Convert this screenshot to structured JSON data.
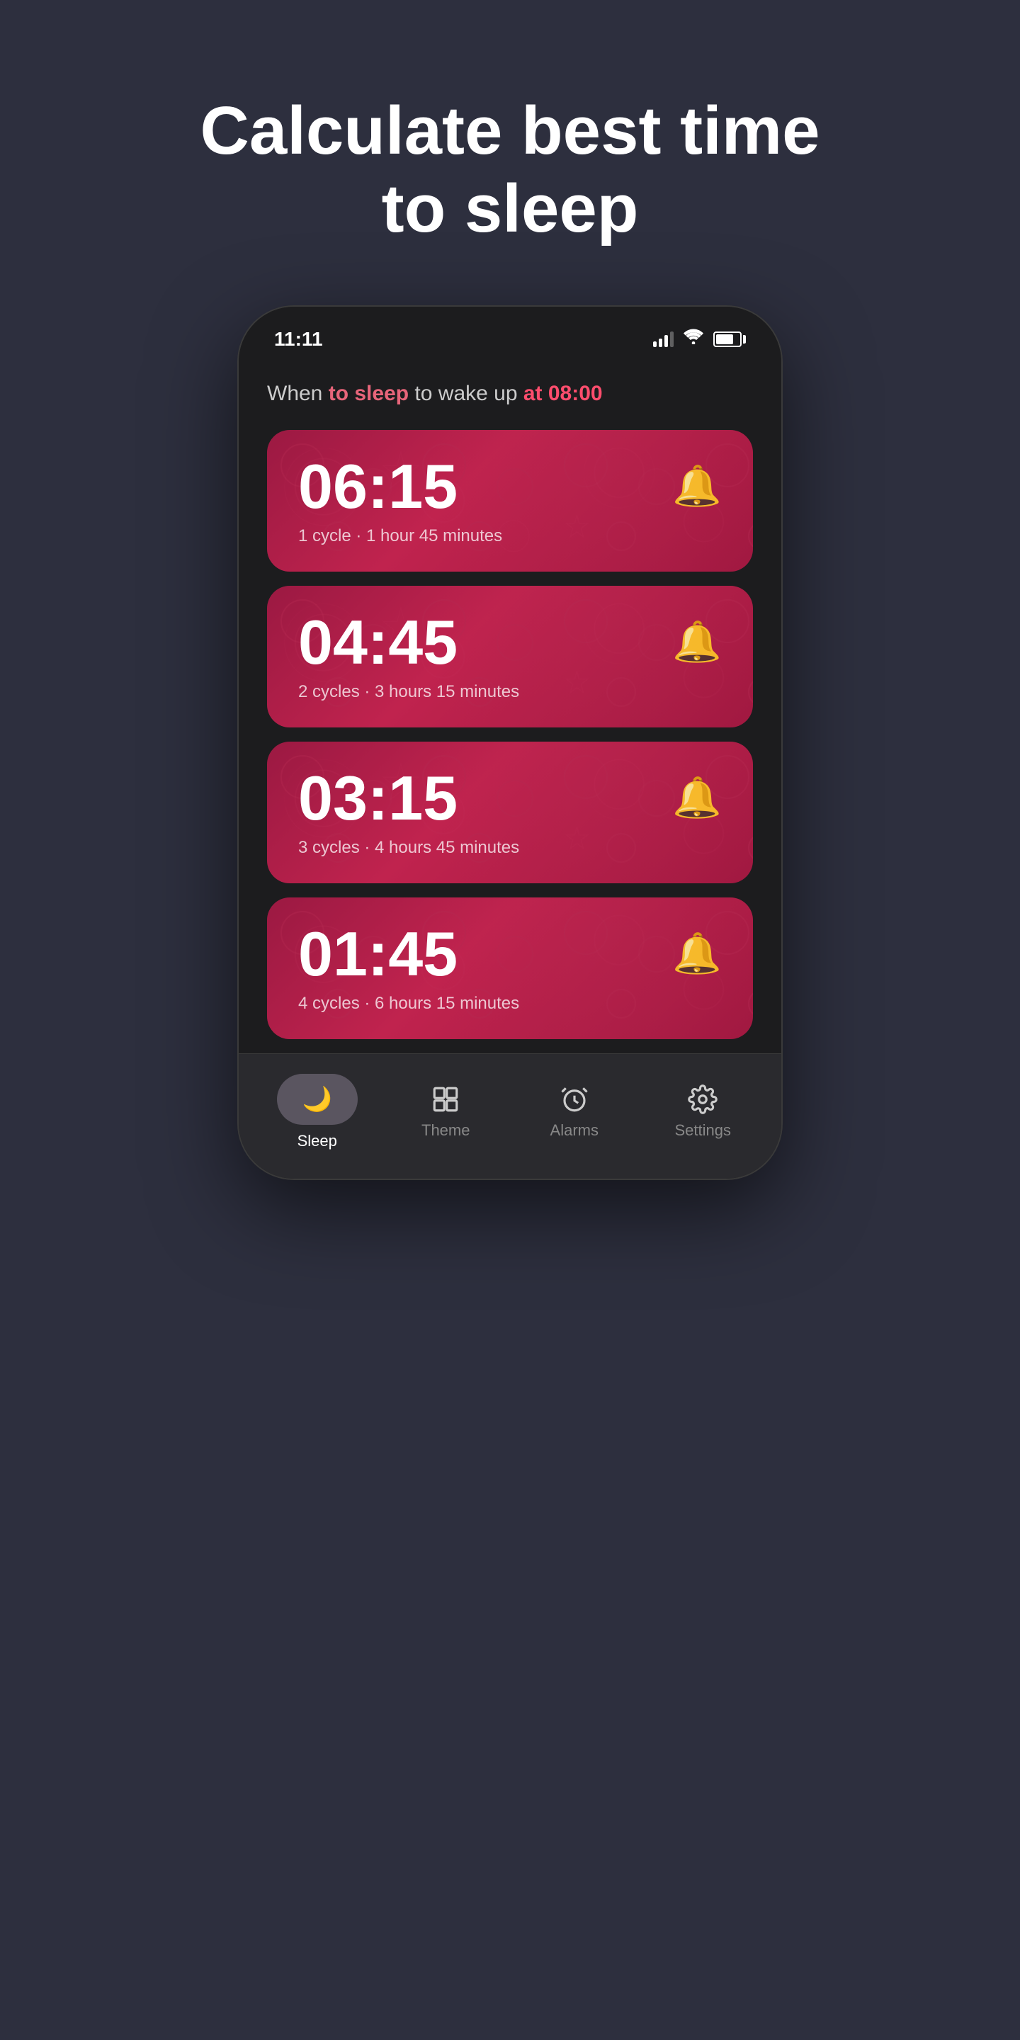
{
  "page": {
    "background": "#2d2f3e",
    "title": "Calculate best time to sleep"
  },
  "status_bar": {
    "time": "11:11",
    "signal_label": "signal",
    "wifi_label": "wifi",
    "battery_label": "battery"
  },
  "subtitle": {
    "text_before": "When ",
    "highlight1": "to sleep",
    "text_middle": " to wake up ",
    "highlight2": "at 08:00"
  },
  "cards": [
    {
      "time": "06:15",
      "cycles": "1 cycle · 1 hour 45 minutes"
    },
    {
      "time": "04:45",
      "cycles": "2 cycles · 3 hours 15 minutes"
    },
    {
      "time": "03:15",
      "cycles": "3 cycles · 4 hours 45 minutes"
    },
    {
      "time": "01:45",
      "cycles": "4 cycles · 6 hours 15 minutes"
    }
  ],
  "nav": {
    "items": [
      {
        "label": "Sleep",
        "icon": "🌙",
        "active": true
      },
      {
        "label": "Theme",
        "icon": "🖌",
        "active": false
      },
      {
        "label": "Alarms",
        "icon": "⏰",
        "active": false
      },
      {
        "label": "Settings",
        "icon": "⚙",
        "active": false
      }
    ]
  }
}
